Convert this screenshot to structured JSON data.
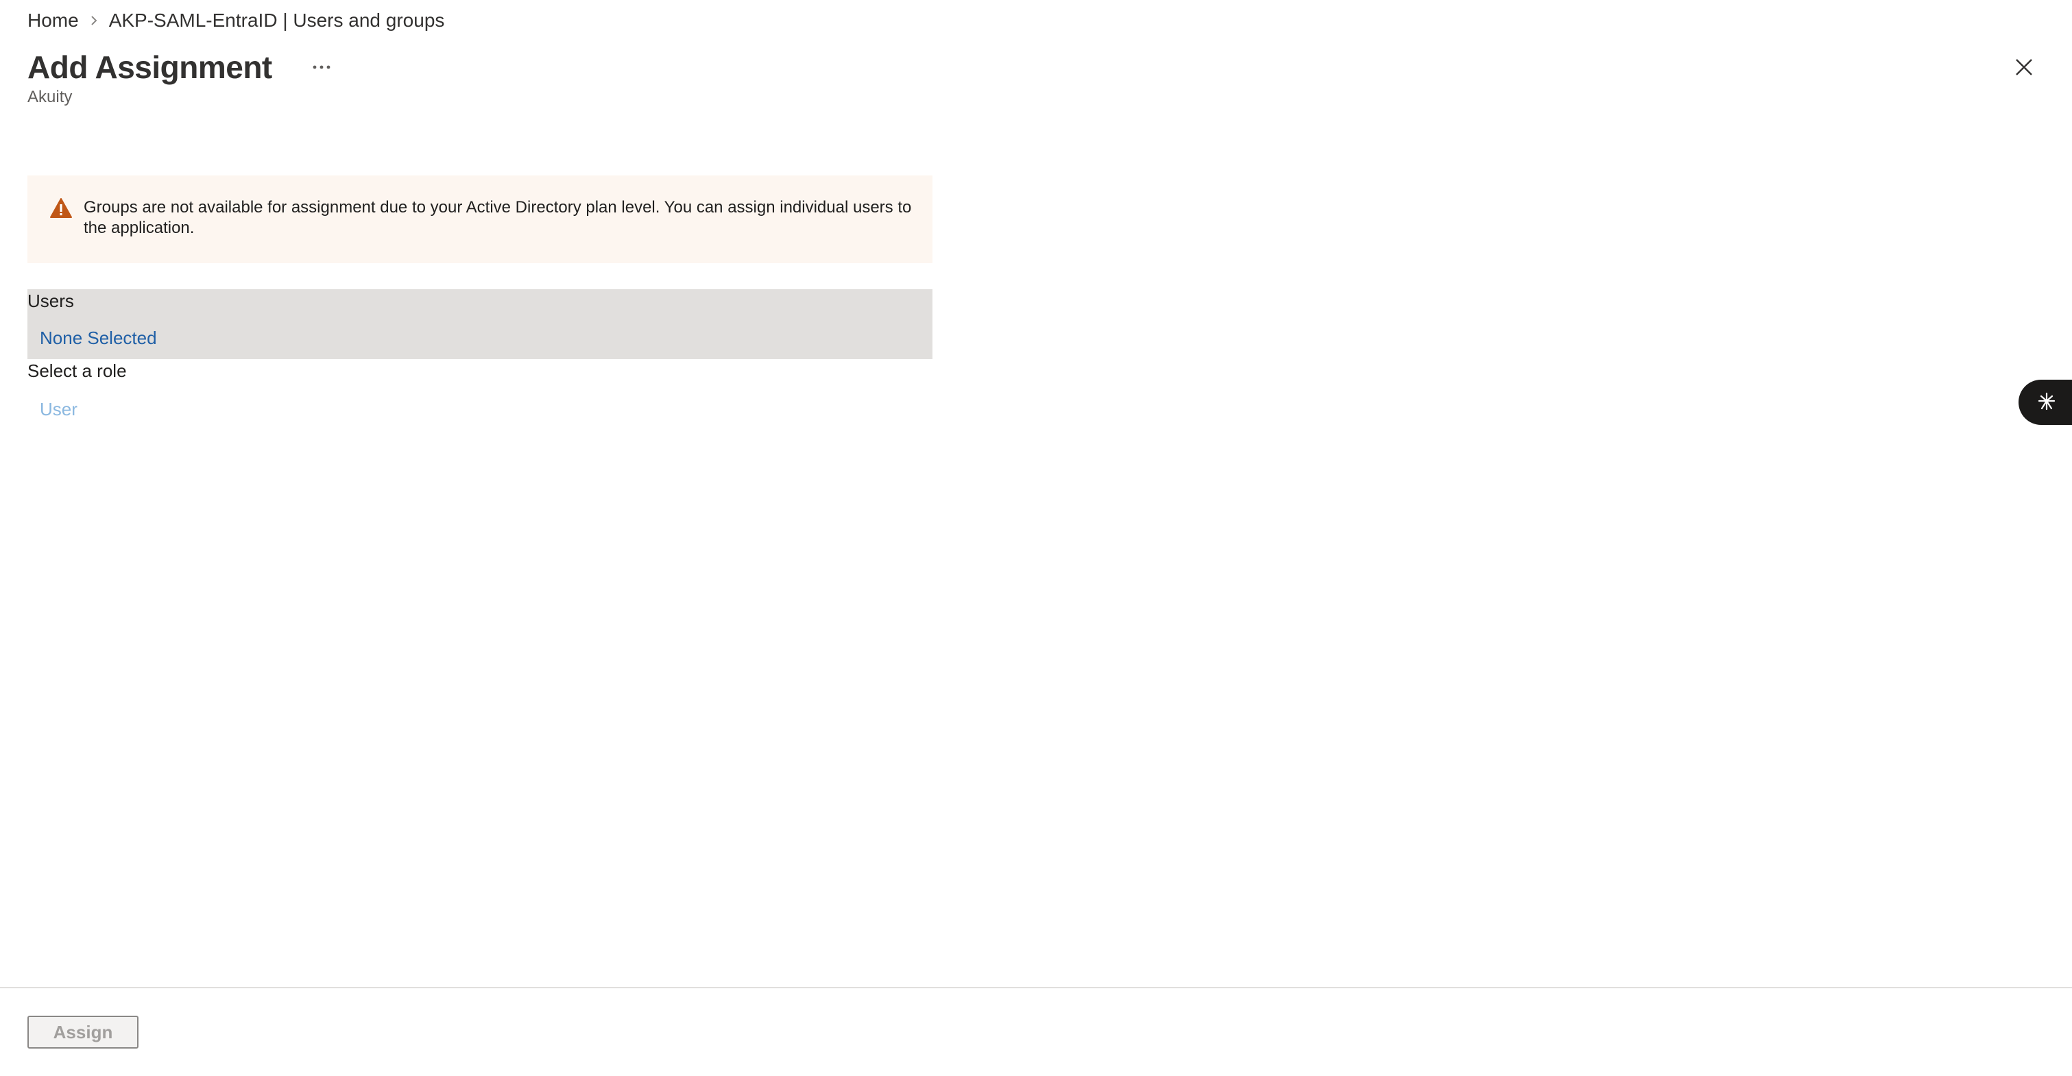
{
  "breadcrumb": {
    "items": [
      {
        "label": "Home"
      },
      {
        "label": "AKP-SAML-EntraID | Users and groups"
      }
    ]
  },
  "header": {
    "title": "Add Assignment",
    "subtitle": "Akuity",
    "more_icon": "ellipsis-icon",
    "close_icon": "close-icon"
  },
  "warning": {
    "icon": "warning-triangle-icon",
    "text": "Groups are not available for assignment due to your Active Directory plan level. You can assign individual users to the application."
  },
  "users": {
    "label": "Users",
    "value": "None Selected"
  },
  "role": {
    "label": "Select a role",
    "value": "User"
  },
  "side_widget": {
    "icon": "sparkle-burst-icon"
  },
  "footer": {
    "assign_label": "Assign"
  },
  "colors": {
    "warning_background": "#fdf6f0",
    "warning_icon": "#c05717",
    "users_panel_background": "#e1dfdd",
    "link": "#1f5fa6",
    "link_disabled": "#8bb8e0",
    "text": "#323130"
  }
}
